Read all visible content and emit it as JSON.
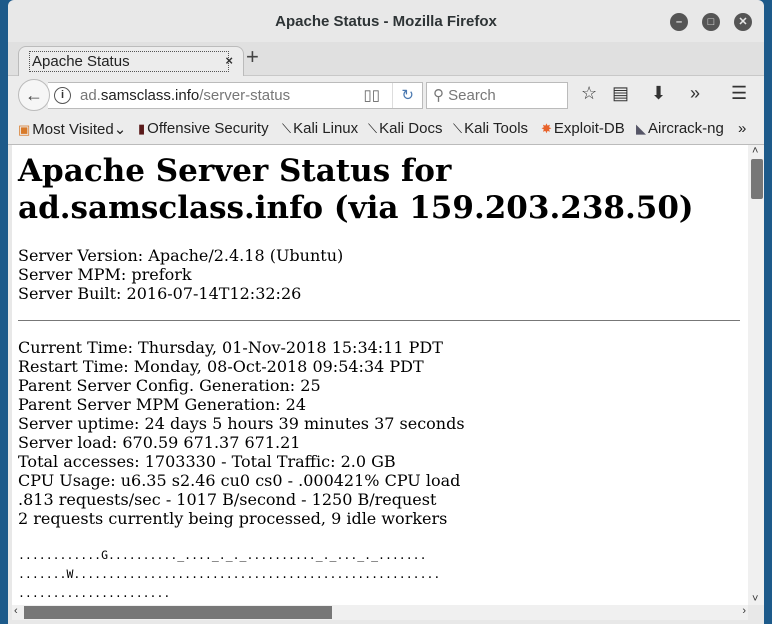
{
  "window": {
    "title": "Apache Status - Mozilla Firefox"
  },
  "tab": {
    "label": "Apache Status",
    "close": "×",
    "new_tab": "+"
  },
  "nav": {
    "url_domain_prefix": "ad.",
    "url_domain": "samsclass.info",
    "url_path": "/server-status",
    "search_placeholder": "Search"
  },
  "bookmarks": [
    {
      "label": "Most Visited",
      "icon": "folder-icon"
    },
    {
      "label": "Offensive Security",
      "icon": "offsec-icon"
    },
    {
      "label": "Kali Linux",
      "icon": "kali-icon"
    },
    {
      "label": "Kali Docs",
      "icon": "kali-icon"
    },
    {
      "label": "Kali Tools",
      "icon": "kali-icon"
    },
    {
      "label": "Exploit-DB",
      "icon": "exploitdb-icon"
    },
    {
      "label": "Aircrack-ng",
      "icon": "aircrack-icon"
    }
  ],
  "page": {
    "heading": "Apache Server Status for ad.samsclass.info (via 159.203.238.50)",
    "server_info": [
      "Server Version: Apache/2.4.18 (Ubuntu)",
      "Server MPM: prefork",
      "Server Built: 2016-07-14T12:32:26"
    ],
    "stats": [
      "Current Time: Thursday, 01-Nov-2018 15:34:11 PDT",
      "Restart Time: Monday, 08-Oct-2018 09:54:34 PDT",
      "Parent Server Config. Generation: 25",
      "Parent Server MPM Generation: 24",
      "Server uptime: 24 days 5 hours 39 minutes 37 seconds",
      "Server load: 670.59 671.37 671.21",
      "Total accesses: 1703330 - Total Traffic: 2.0 GB",
      "CPU Usage: u6.35 s2.46 cu0 cs0 - .000421% CPU load",
      ".813 requests/sec - 1017 B/second - 1250 B/request",
      "2 requests currently being processed, 9 idle workers"
    ],
    "scoreboard": [
      "............G.........._...._._._.........._._..._._.......",
      ".......W.....................................................",
      "......................"
    ]
  }
}
